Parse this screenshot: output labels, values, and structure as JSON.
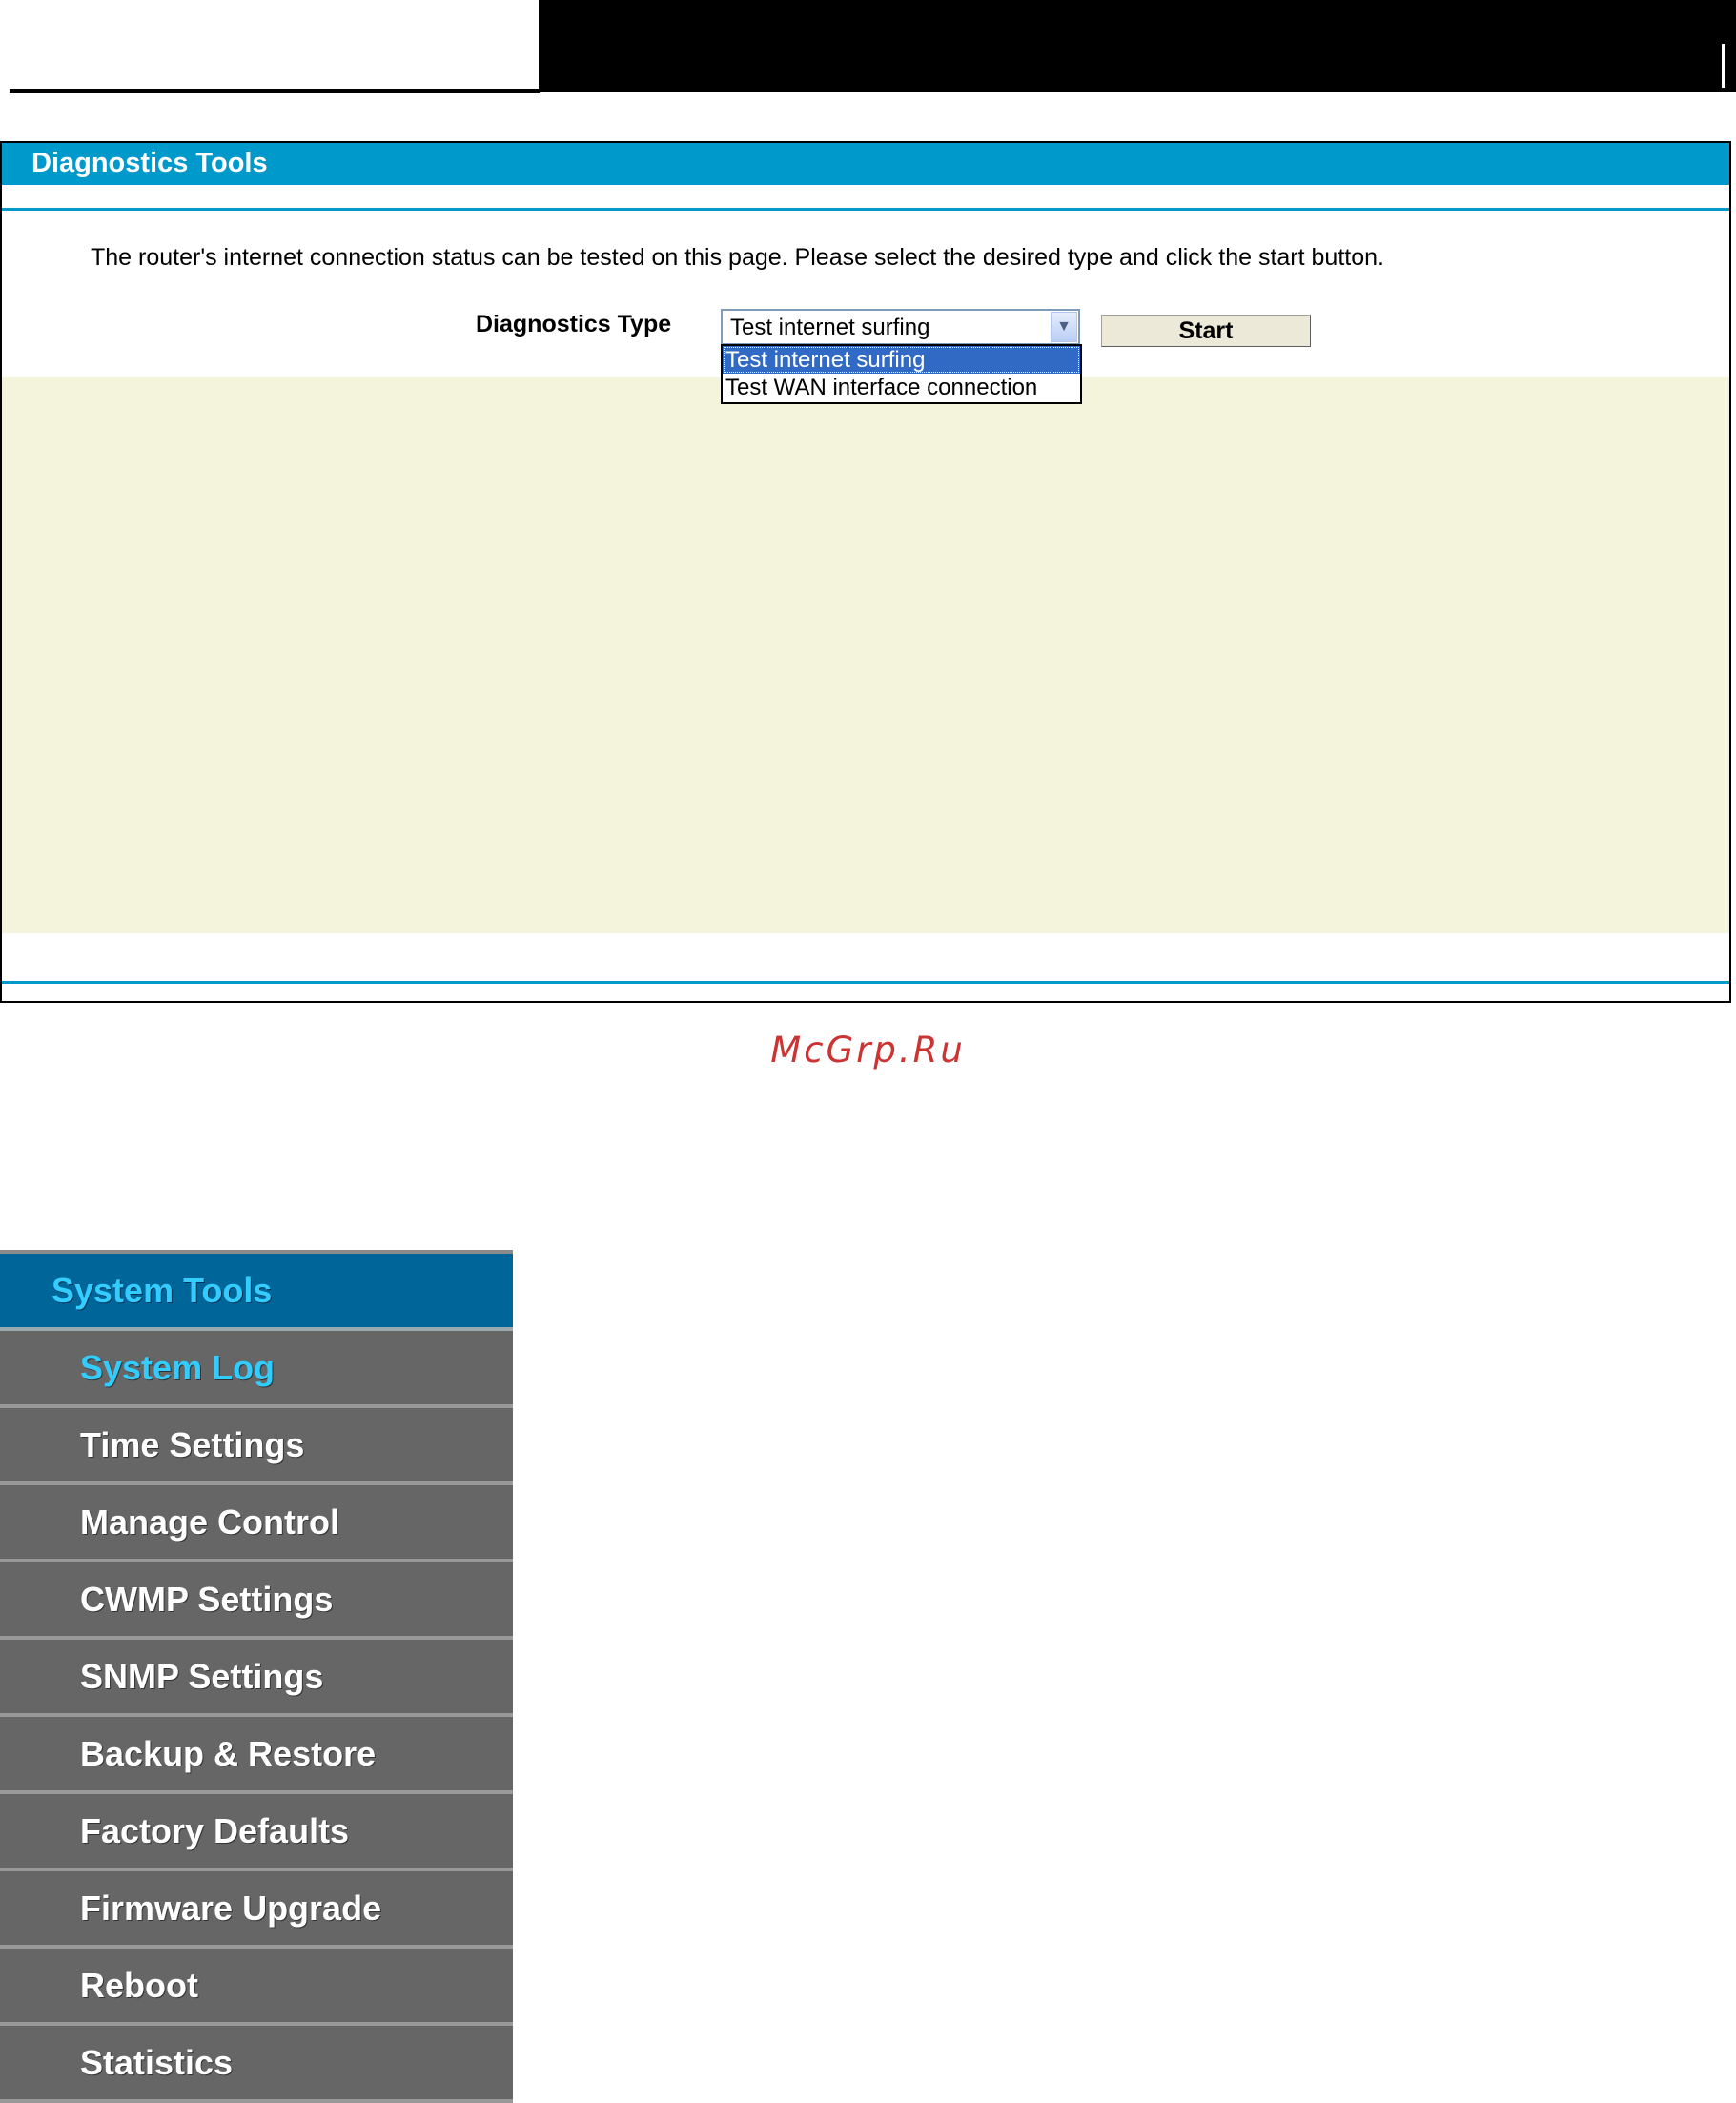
{
  "panel": {
    "title": "Diagnostics Tools",
    "intro": "The router's internet connection status can be tested on this page. Please select the desired type and click the start button.",
    "diagnostics_type_label": "Diagnostics Type",
    "select": {
      "value": "Test internet surfing",
      "options": [
        "Test internet surfing",
        "Test WAN interface connection"
      ]
    },
    "start_label": "Start"
  },
  "watermark": "McGrp.Ru",
  "menu": {
    "section": "System Tools",
    "items": [
      "System Log",
      "Time Settings",
      "Manage Control",
      "CWMP Settings",
      "SNMP Settings",
      "Backup & Restore",
      "Factory Defaults",
      "Firmware Upgrade",
      "Reboot",
      "Statistics"
    ]
  },
  "colors": {
    "accent": "#0099cc",
    "menu_header": "#006699",
    "menu_background": "#666666",
    "menu_active_text": "#33ccff",
    "result_background": "#f4f3dc",
    "dropdown_selected": "#316ac5"
  }
}
